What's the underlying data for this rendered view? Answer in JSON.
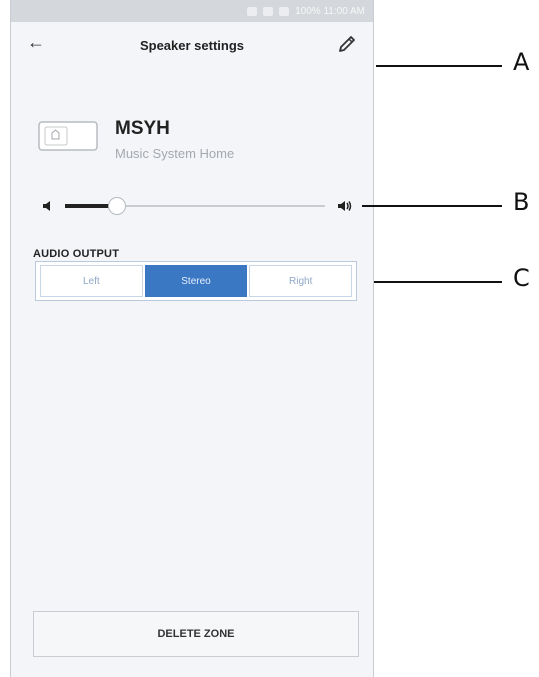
{
  "statusbar": {
    "text": "100% 11:00 AM"
  },
  "header": {
    "title": "Speaker settings"
  },
  "speaker": {
    "name": "MSYH",
    "subtitle": "Music System Home"
  },
  "volume": {
    "level": 0.2
  },
  "audio_output": {
    "label": "AUDIO OUTPUT",
    "options": [
      "Left",
      "Stereo",
      "Right"
    ],
    "selected": "Stereo"
  },
  "footer": {
    "delete_label": "DELETE ZONE"
  },
  "callouts": {
    "a": "A",
    "b": "B",
    "c": "C"
  },
  "colors": {
    "accent": "#3a78c4",
    "background": "#f3f5f8"
  }
}
